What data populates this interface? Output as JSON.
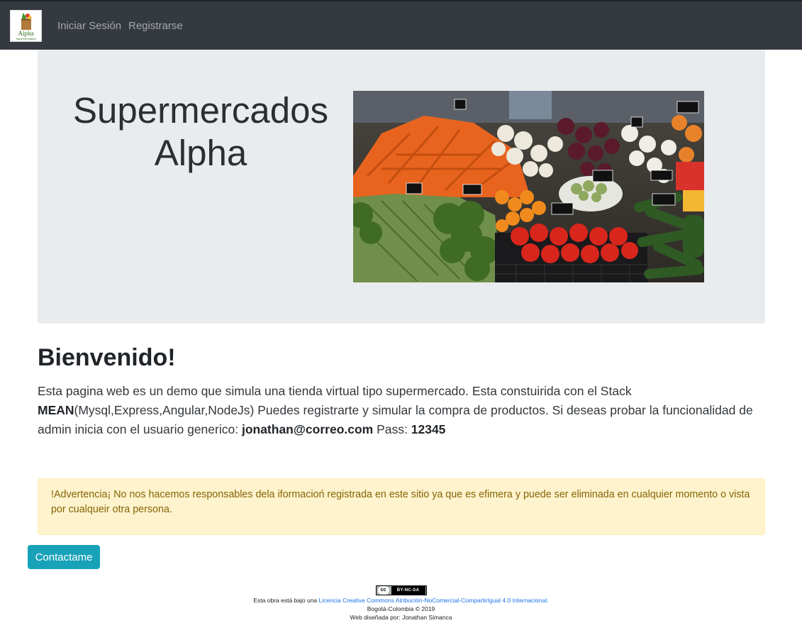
{
  "navbar": {
    "logo": {
      "title": "Alpha",
      "subtitle": "Supermercados"
    },
    "links": [
      {
        "label": "Iniciar Sesión"
      },
      {
        "label": "Registrarse"
      }
    ]
  },
  "hero": {
    "title_line1": "Supermercados",
    "title_line2": "Alpha",
    "image": "vegetable-market-photo"
  },
  "welcome": {
    "title": "Bienvenido!",
    "text_1": "Esta pagina web es un demo que simula una tienda virtual tipo supermercado. Esta constuirida con el Stack ",
    "stack": "MEAN",
    "text_2": "(Mysql,Express,Angular,NodeJs) Puedes registrarte y simular la compra de productos. Si deseas probar la funcionalidad de admin inicia con el usuario generico: ",
    "user": "jonathan@correo.com",
    "text_3": " Pass: ",
    "pass": "12345"
  },
  "alert": {
    "text": "!Advertencia¡ No nos hacemos responsables dela iformacioń registrada en este sitio ya que es efimera y puede ser eliminada en cualquier momento o vista por cualqueir otra persona."
  },
  "contact_button": {
    "label": "Contactame"
  },
  "footer": {
    "badge_cc": "cc",
    "badge_terms": "BY-NC-SA",
    "license_prefix": "Esta obra está bajo una ",
    "license_link": "Licencia Creative Commons Atribución-NoComercial-CompartirIgual 4.0 Internacional.",
    "location": "Bogotá-Colombia © 2019",
    "credits": "Web diseñada por: Jonathan Simanca"
  },
  "colors": {
    "navbar_bg": "#343a40",
    "jumbotron_bg": "#e9ecef",
    "alert_bg": "#fff3cd",
    "alert_text": "#856404",
    "button_info": "#17a2b8",
    "link": "#1a73e8"
  }
}
